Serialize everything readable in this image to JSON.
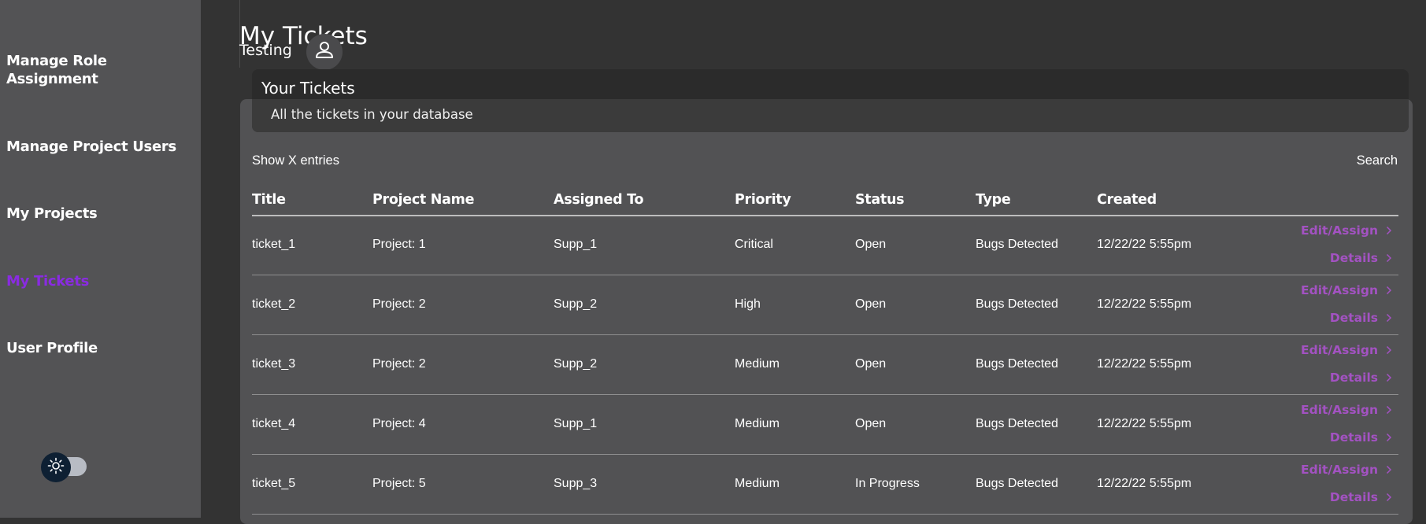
{
  "sidebar": {
    "items": [
      {
        "label": "Manage Role Assignment",
        "active": false
      },
      {
        "label": "Manage Project Users",
        "active": false
      },
      {
        "label": "My Projects",
        "active": false
      },
      {
        "label": "My Tickets",
        "active": true
      },
      {
        "label": "User Profile",
        "active": false
      }
    ],
    "theme_toggle_icon": "sun-icon"
  },
  "header": {
    "title": "My Tickets",
    "user_name": "Testing",
    "avatar_icon": "user-icon"
  },
  "card": {
    "title": "Your Tickets",
    "subtitle": "All the tickets in your database",
    "show_entries": "Show X entries",
    "search": "Search"
  },
  "table": {
    "columns": [
      "Title",
      "Project Name",
      "Assigned To",
      "Priority",
      "Status",
      "Type",
      "Created"
    ],
    "edit_label": "Edit/Assign",
    "details_label": "Details",
    "rows": [
      {
        "title": "ticket_1",
        "project": "Project: 1",
        "assigned": "Supp_1",
        "priority": "Critical",
        "status": "Open",
        "type": "Bugs Detected",
        "created": "12/22/22 5:55pm"
      },
      {
        "title": "ticket_2",
        "project": "Project: 2",
        "assigned": "Supp_2",
        "priority": "High",
        "status": "Open",
        "type": "Bugs Detected",
        "created": "12/22/22 5:55pm"
      },
      {
        "title": "ticket_3",
        "project": "Project: 2",
        "assigned": "Supp_2",
        "priority": "Medium",
        "status": "Open",
        "type": "Bugs Detected",
        "created": "12/22/22 5:55pm"
      },
      {
        "title": "ticket_4",
        "project": "Project: 4",
        "assigned": "Supp_1",
        "priority": "Medium",
        "status": "Open",
        "type": "Bugs Detected",
        "created": "12/22/22 5:55pm"
      },
      {
        "title": "ticket_5",
        "project": "Project: 5",
        "assigned": "Supp_3",
        "priority": "Medium",
        "status": "In Progress",
        "type": "Bugs Detected",
        "created": "12/22/22 5:55pm"
      }
    ]
  },
  "colors": {
    "accent": "#8a2be2",
    "action": "#a352c2",
    "sidebar_bg": "#535355",
    "page_bg": "#333333",
    "card_bg": "#525254"
  }
}
